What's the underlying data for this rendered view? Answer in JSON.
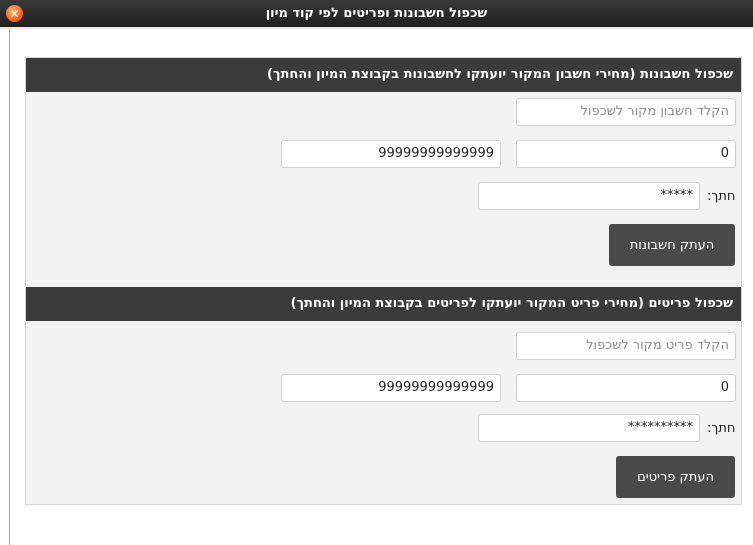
{
  "window": {
    "title": "שכפול חשבונות ופריטים לפי קוד מיון",
    "close_symbol": "✕"
  },
  "accounts": {
    "header": "שכפול חשבונות (מחירי חשבון המקור יועתקו לחשבונות בקבוצת המיון והחתך)",
    "source_placeholder": "הקלד חשבון מקור לשכפול",
    "range_from": "0",
    "range_to": "99999999999999",
    "slice_label": "חתך:",
    "slice_value": "*****",
    "copy_button": "העתק חשבונות"
  },
  "items": {
    "header": "שכפול פריטים (מחירי פריט המקור יועתקו לפריטים בקבוצת המיון והחתך)",
    "source_placeholder": "הקלד פריט מקור לשכפול",
    "range_from": "0",
    "range_to": "99999999999999",
    "slice_label": "חתך:",
    "slice_value": "**********",
    "copy_button": "העתק פריטים"
  }
}
